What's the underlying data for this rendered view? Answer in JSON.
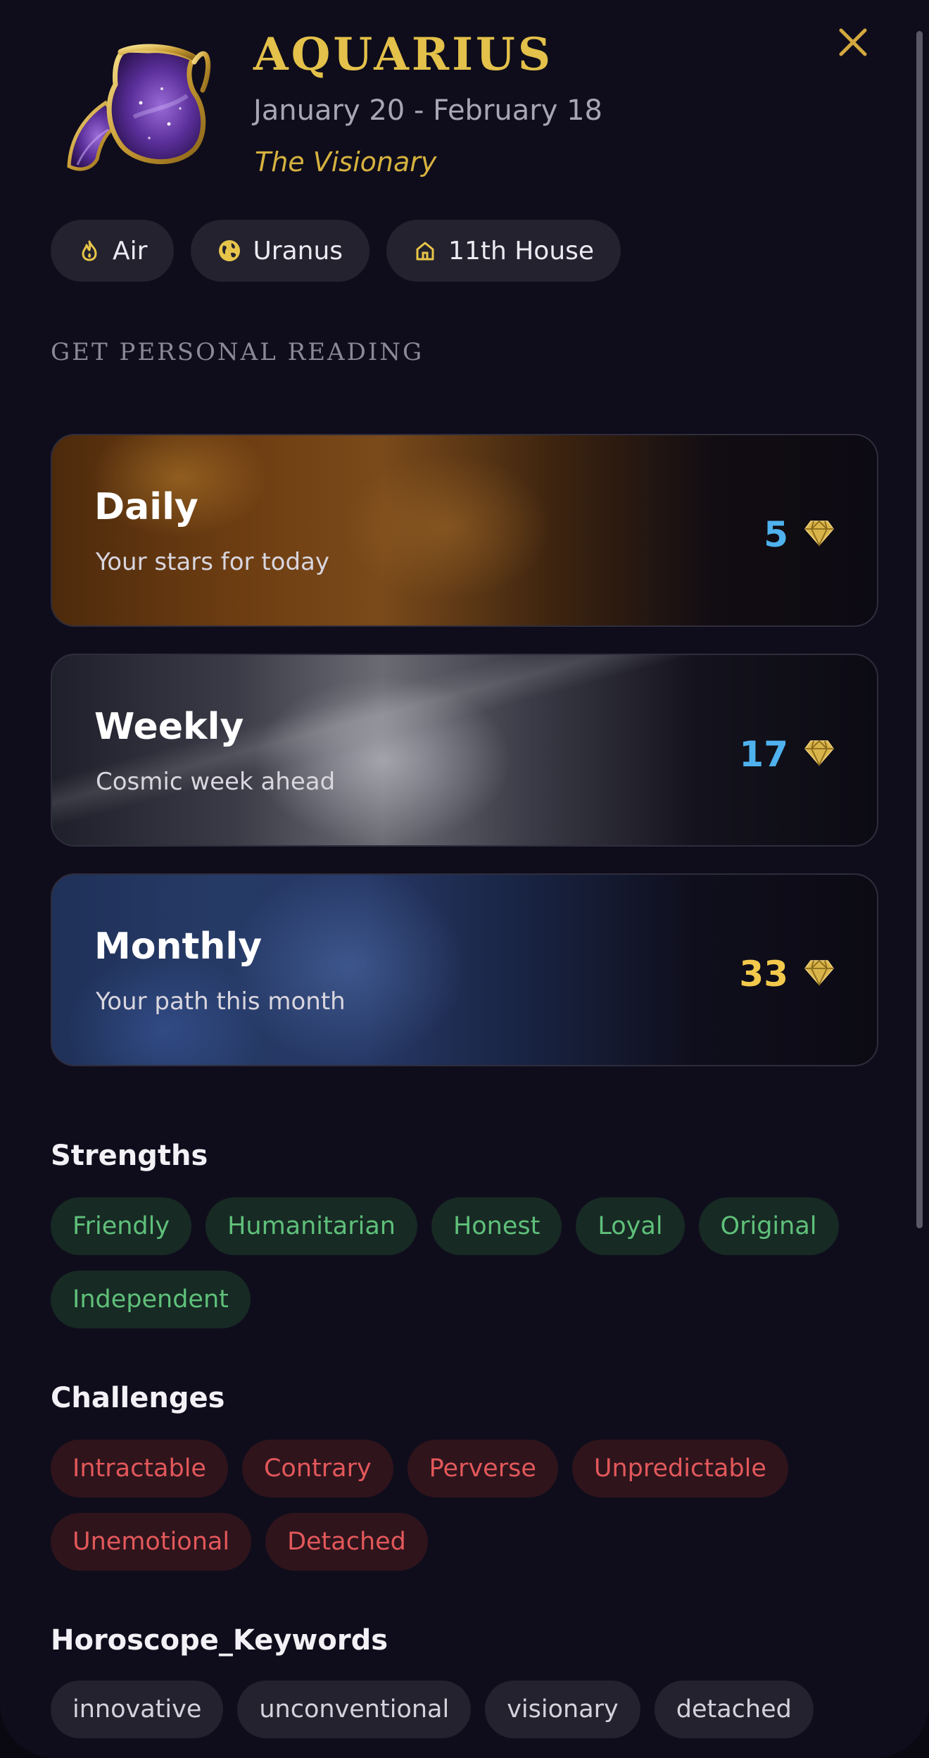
{
  "sign": {
    "name": "AQUARIUS",
    "dates": "January 20 - February 18",
    "tagline": "The Visionary",
    "artwork_icon": "water-jar-icon",
    "accent_color": "#e3c14a"
  },
  "close_icon": "close-icon",
  "attributes": [
    {
      "icon": "flame-icon",
      "label": "Air"
    },
    {
      "icon": "globe-icon",
      "label": "Uranus"
    },
    {
      "icon": "house-icon",
      "label": "11th House"
    }
  ],
  "reading": {
    "heading": "GET PERSONAL READING",
    "cards": [
      {
        "title": "Daily",
        "subtitle": "Your stars for today",
        "price": "5",
        "price_color": "#4fb2ee",
        "currency_icon": "gem-icon"
      },
      {
        "title": "Weekly",
        "subtitle": "Cosmic week ahead",
        "price": "17",
        "price_color": "#4fb2ee",
        "currency_icon": "gem-icon"
      },
      {
        "title": "Monthly",
        "subtitle": "Your path this month",
        "price": "33",
        "price_color": "#f2c94c",
        "currency_icon": "gem-icon"
      }
    ]
  },
  "strengths": {
    "title": "Strengths",
    "items": [
      "Friendly",
      "Humanitarian",
      "Honest",
      "Loyal",
      "Original",
      "Independent"
    ]
  },
  "challenges": {
    "title": "Challenges",
    "items": [
      "Intractable",
      "Contrary",
      "Perverse",
      "Unpredictable",
      "Unemotional",
      "Detached"
    ]
  },
  "keywords": {
    "title": "Horoscope_Keywords",
    "items": [
      "innovative",
      "unconventional",
      "visionary",
      "detached"
    ]
  }
}
